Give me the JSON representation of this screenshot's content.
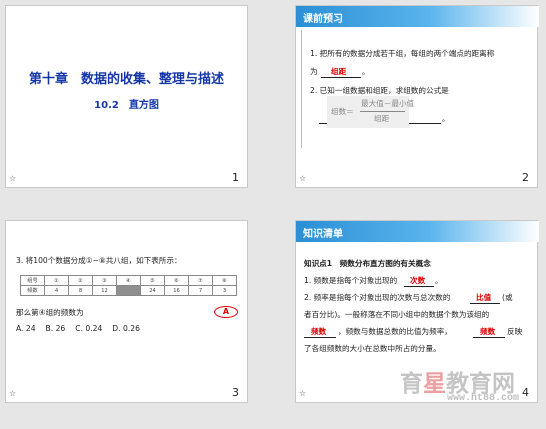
{
  "slides": [
    {
      "number": "1",
      "star": "☆",
      "title": "第十章　数据的收集、整理与描述",
      "subtitle": "10.2　直方图"
    },
    {
      "number": "2",
      "star": "☆",
      "header": "课前预习",
      "q1_a": "1. 把所有的数据分成若干组，每组的两个端点的距离称",
      "q1_b": "为",
      "q1_ans": "组距",
      "q1_end": "。",
      "q2": "2. 已知一组数据和组距，求组数的公式是",
      "formula_left": "组数＝",
      "formula_num": "最大值－最小值",
      "formula_den": "组距",
      "formula_end": "。"
    },
    {
      "number": "3",
      "star": "☆",
      "q": "3. 将100个数据分成①~⑧共八组，如下表所示：",
      "table": {
        "headers": [
          "组号",
          "①",
          "②",
          "③",
          "④",
          "⑤",
          "⑥",
          "⑦",
          "⑧"
        ],
        "row": [
          "频数",
          "4",
          "8",
          "12",
          "",
          "24",
          "16",
          "7",
          "3"
        ]
      },
      "prompt": "那么第④组的频数为",
      "answer": "A",
      "options": "A. 24　 B. 26　 C. 0.24　 D. 0.26"
    },
    {
      "number": "4",
      "star": "☆",
      "header": "知识清单",
      "k_title": "知识点1　频数分布直方图的有关概念",
      "k1_a": "1. 频数是指每个对象出现的",
      "k1_ans": "次数",
      "k1_end": "。",
      "k2_a": "2. 频率是指每个对象出现的次数与总次数的",
      "k2_ans": "比值",
      "k2_end": "(或",
      "k2_b": "者百分比)。一般称落在不同小组中的数据个数为该组的",
      "k2_c_ans1": "频数",
      "k2_c_mid": "，频数与数据总数的比值为频率，",
      "k2_c_ans2": "频数",
      "k2_c_end": "反映",
      "k2_d": "了各组频数的大小在总数中所占的分量。",
      "watermark_cn": "育星教育网",
      "watermark_url": "www.ht88.com"
    }
  ]
}
